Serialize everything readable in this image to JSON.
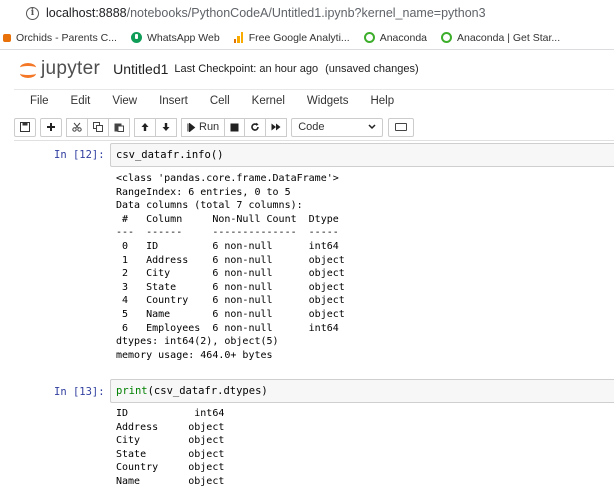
{
  "browser": {
    "url_host": "localhost:8888",
    "url_path": "/notebooks/PythonCodeA/Untitled1.ipynb?kernel_name=python3",
    "bookmarks": [
      {
        "label": "Orchids - Parents C...",
        "icon": "orchid-icon"
      },
      {
        "label": "WhatsApp Web",
        "icon": "whatsapp-icon"
      },
      {
        "label": "Free Google Analyti...",
        "icon": "analytics-icon"
      },
      {
        "label": "Anaconda",
        "icon": "anaconda-icon"
      },
      {
        "label": "Anaconda | Get Star...",
        "icon": "anaconda-icon"
      }
    ]
  },
  "header": {
    "logo_text": "jupyter",
    "notebook_name": "Untitled1",
    "checkpoint": "Last Checkpoint: an hour ago",
    "status": "(unsaved changes)"
  },
  "menu": [
    "File",
    "Edit",
    "View",
    "Insert",
    "Cell",
    "Kernel",
    "Widgets",
    "Help"
  ],
  "toolbar": {
    "run_label": "Run",
    "cell_type": "Code"
  },
  "cells": [
    {
      "prompt": "In [12]:",
      "code_obj": "csv_datafr",
      "code_call": ".info()",
      "output": "<class 'pandas.core.frame.DataFrame'>\nRangeIndex: 6 entries, 0 to 5\nData columns (total 7 columns):\n #   Column     Non-Null Count  Dtype \n---  ------     --------------  ----- \n 0   ID         6 non-null      int64 \n 1   Address    6 non-null      object\n 2   City       6 non-null      object\n 3   State      6 non-null      object\n 4   Country    6 non-null      object\n 5   Name       6 non-null      object\n 6   Employees  6 non-null      int64 \ndtypes: int64(2), object(5)\nmemory usage: 464.0+ bytes"
    },
    {
      "prompt": "In [13]:",
      "code_fn": "print",
      "code_args": "(csv_datafr.dtypes)",
      "output": "ID           int64\nAddress     object\nCity        object\nState       object\nCountry     object\nName        object"
    }
  ]
}
